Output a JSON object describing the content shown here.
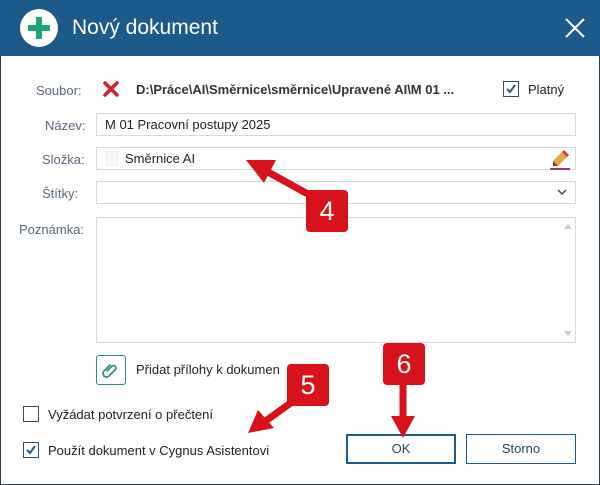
{
  "dialog": {
    "title": "Nový dokument",
    "icon": "plus-circle-icon",
    "accent_color": "#1c5a8a",
    "icon_color": "#1fa37a"
  },
  "form": {
    "file": {
      "label": "Soubor:",
      "path": "D:\\Práce\\AI\\Směrnice\\směrnice\\Upravené AI\\M 01 ...",
      "valid_label": "Platný",
      "valid_checked": true
    },
    "name": {
      "label": "Název:",
      "value": "M 01 Pracovní postupy 2025"
    },
    "folder": {
      "label": "Složka:",
      "value": "Směrnice AI"
    },
    "tags": {
      "label": "Štítky:",
      "value": ""
    },
    "note": {
      "label": "Poznámka:",
      "value": ""
    },
    "attachments_label": "Přidat přílohy k dokumen"
  },
  "options": {
    "read_receipt": {
      "label": "Vyžádat potvrzení o přečtení",
      "checked": false
    },
    "use_assistant": {
      "label": "Použít dokument v Cygnus Asistentovi",
      "checked": true
    }
  },
  "buttons": {
    "ok": "OK",
    "cancel": "Storno"
  },
  "annotations": {
    "callout_4": "4",
    "callout_5": "5",
    "callout_6": "6",
    "color": "#d8121a"
  }
}
